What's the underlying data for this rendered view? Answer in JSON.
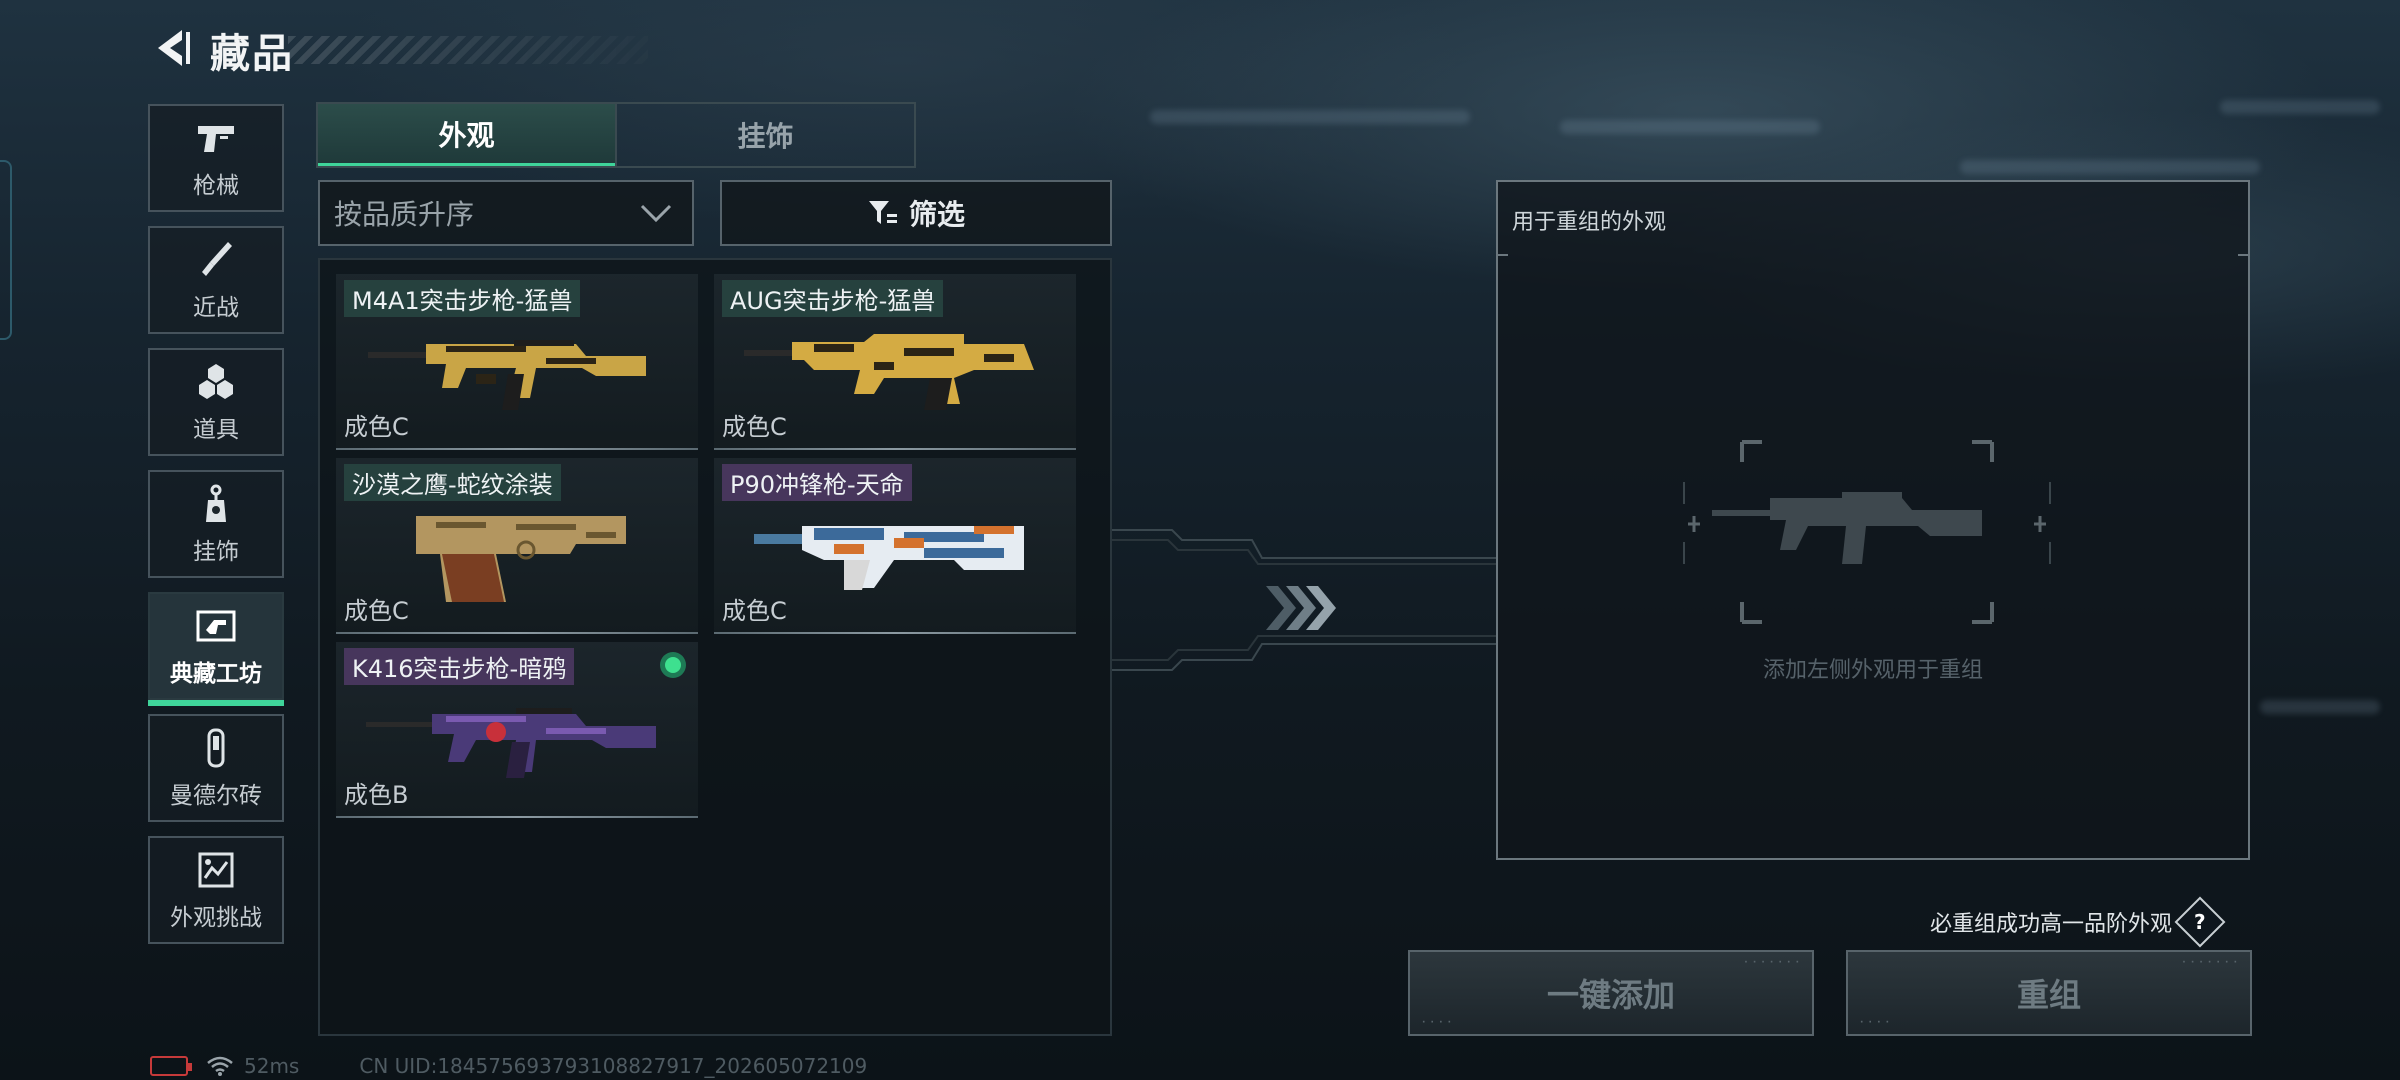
{
  "header": {
    "title": "藏品",
    "back_icon": "back-arrow-icon"
  },
  "nav": {
    "items": [
      {
        "label": "枪械",
        "icon": "pistol-icon",
        "active": false
      },
      {
        "label": "近战",
        "icon": "knife-icon",
        "active": false
      },
      {
        "label": "道具",
        "icon": "grenade-icon",
        "active": false
      },
      {
        "label": "挂饰",
        "icon": "charm-icon",
        "active": false
      },
      {
        "label": "典藏工坊",
        "icon": "workshop-icon",
        "active": true
      },
      {
        "label": "曼德尔砖",
        "icon": "brick-icon",
        "active": false
      },
      {
        "label": "外观挑战",
        "icon": "challenge-icon",
        "active": false
      }
    ]
  },
  "tabs": [
    {
      "label": "外观",
      "active": true
    },
    {
      "label": "挂饰",
      "active": false
    }
  ],
  "sort": {
    "value": "按品质升序"
  },
  "filter": {
    "label": "筛选"
  },
  "skins": [
    {
      "name": "M4A1突击步枪-猛兽",
      "grade": "成色C",
      "tag_color": "green",
      "selected": false
    },
    {
      "name": "AUG突击步枪-猛兽",
      "grade": "成色C",
      "tag_color": "green",
      "selected": false
    },
    {
      "name": "沙漠之鹰-蛇纹涂装",
      "grade": "成色C",
      "tag_color": "green",
      "selected": false
    },
    {
      "name": "P90冲锋枪-天命",
      "grade": "成色C",
      "tag_color": "purple",
      "selected": false
    },
    {
      "name": "K416突击步枪-暗鸦",
      "grade": "成色B",
      "tag_color": "purple",
      "selected": true
    }
  ],
  "recombine": {
    "panel_title": "用于重组的外观",
    "hint": "添加左侧外观用于重组",
    "guarantee": "必重组成功高一品阶外观",
    "help_label": "?"
  },
  "buttons": {
    "add_all": "一键添加",
    "recombine": "重组"
  },
  "status": {
    "ping": "52ms",
    "uid": "CN UID:18457569379310882791​7_202605072109"
  },
  "colors": {
    "accent_green": "#3fd49a",
    "battery_low": "#c63a3a",
    "tag_green": "#28463f",
    "tag_purple": "#4c3862"
  }
}
